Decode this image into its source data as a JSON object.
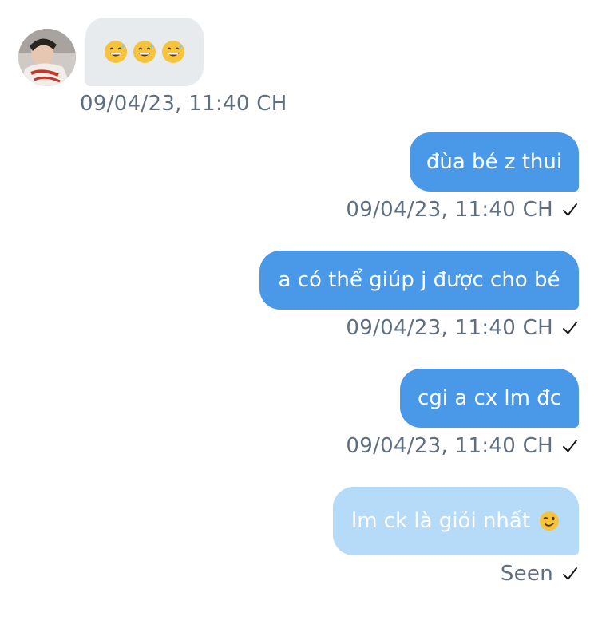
{
  "incoming": {
    "emoji": [
      "grinning-sweat",
      "grinning-sweat",
      "grinning-sweat"
    ],
    "timestamp": "09/04/23, 11:40 CH"
  },
  "outgoing": [
    {
      "text": "đùa bé z thui",
      "timestamp": "09/04/23, 11:40 CH"
    },
    {
      "text": "a có thể giúp j được cho bé",
      "timestamp": "09/04/23, 11:40 CH"
    },
    {
      "text": "cgi a cx lm đc",
      "timestamp": "09/04/23, 11:40 CH"
    },
    {
      "text": "lm ck là giỏi nhất",
      "emoji": "winking-face",
      "status": "Seen"
    }
  ],
  "colors": {
    "outgoing_bubble": "#4a98e8",
    "pending_bubble": "#b6dbf8",
    "incoming_bubble": "#e7ebee",
    "meta_text": "#5f6f7f"
  }
}
